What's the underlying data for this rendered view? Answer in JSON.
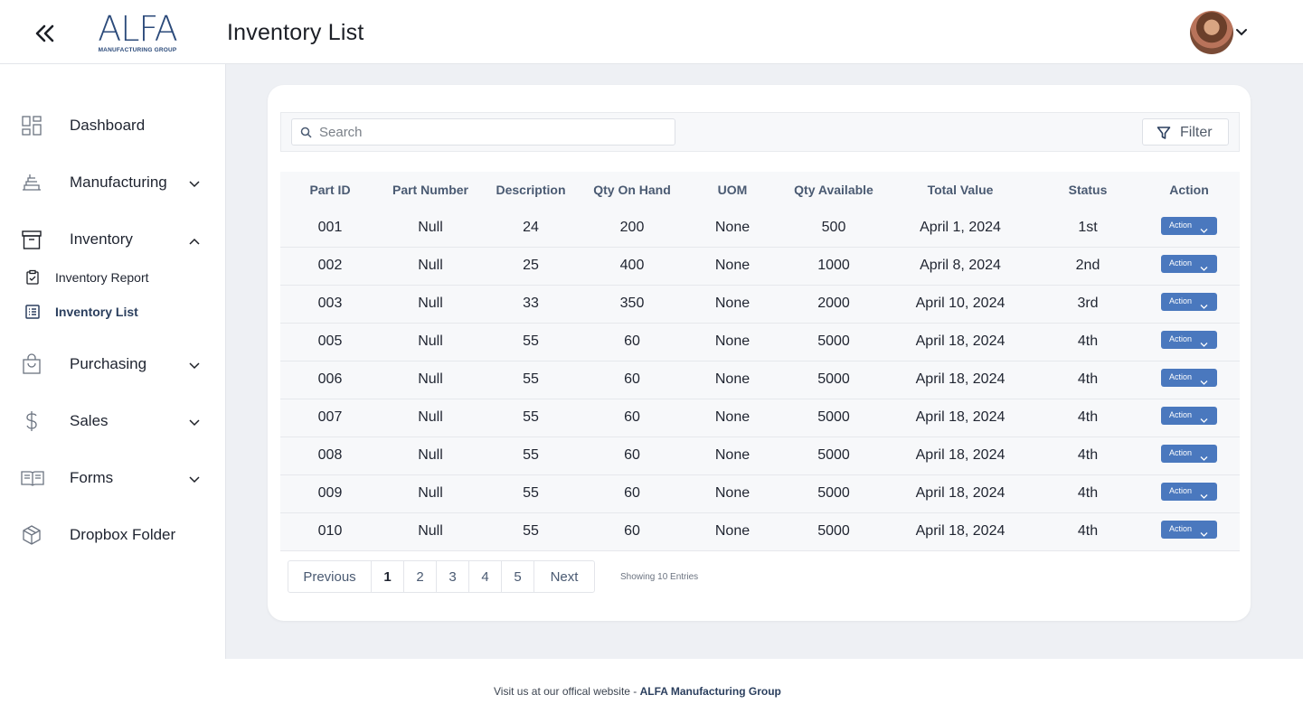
{
  "header": {
    "logo_text": "ALFA",
    "logo_subtitle": "MANUFACTURING GROUP",
    "page_title": "Inventory List"
  },
  "sidebar": {
    "items": [
      {
        "label": "Dashboard",
        "icon": "dashboard-grid-icon"
      },
      {
        "label": "Manufacturing",
        "icon": "manufacturing-icon",
        "expandable": true
      },
      {
        "label": "Inventory",
        "icon": "inventory-box-icon",
        "expanded": true
      },
      {
        "label": "Purchasing",
        "icon": "shopping-bag-icon",
        "expandable": true
      },
      {
        "label": "Sales",
        "icon": "dollar-icon",
        "expandable": true
      },
      {
        "label": "Forms",
        "icon": "book-icon",
        "expandable": true
      },
      {
        "label": "Dropbox Folder",
        "icon": "package-icon"
      }
    ],
    "inventory_sub": [
      {
        "label": "Inventory Report",
        "icon": "clipboard-icon"
      },
      {
        "label": "Inventory List",
        "icon": "list-icon",
        "active": true
      }
    ]
  },
  "toolbar": {
    "search_placeholder": "Search",
    "filter_label": "Filter"
  },
  "table": {
    "columns": [
      "Part ID",
      "Part Number",
      "Description",
      "Qty On Hand",
      "UOM",
      "Qty Available",
      "Total Value",
      "Status",
      "Action"
    ],
    "rows": [
      [
        "001",
        "Null",
        "24",
        "200",
        "None",
        "500",
        "April 1, 2024",
        "1st",
        "Action"
      ],
      [
        "002",
        "Null",
        "25",
        "400",
        "None",
        "1000",
        "April 8, 2024",
        "2nd",
        "Action"
      ],
      [
        "003",
        "Null",
        "33",
        "350",
        "None",
        "2000",
        "April 10, 2024",
        "3rd",
        "Action"
      ],
      [
        "005",
        "Null",
        "55",
        "60",
        "None",
        "5000",
        "April 18, 2024",
        "4th",
        "Action"
      ],
      [
        "006",
        "Null",
        "55",
        "60",
        "None",
        "5000",
        "April 18, 2024",
        "4th",
        "Action"
      ],
      [
        "007",
        "Null",
        "55",
        "60",
        "None",
        "5000",
        "April 18, 2024",
        "4th",
        "Action"
      ],
      [
        "008",
        "Null",
        "55",
        "60",
        "None",
        "5000",
        "April 18, 2024",
        "4th",
        "Action"
      ],
      [
        "009",
        "Null",
        "55",
        "60",
        "None",
        "5000",
        "April 18, 2024",
        "4th",
        "Action"
      ],
      [
        "010",
        "Null",
        "55",
        "60",
        "None",
        "5000",
        "April 18, 2024",
        "4th",
        "Action"
      ]
    ]
  },
  "pagination": {
    "previous": "Previous",
    "pages": [
      "1",
      "2",
      "3",
      "4",
      "5"
    ],
    "current": "1",
    "next": "Next",
    "showing": "Showing 10 Entries"
  },
  "footer": {
    "text": "Visit us at our offical website - ",
    "link": "ALFA Manufacturing Group"
  },
  "colors": {
    "accent": "#4a78be",
    "brand": "#2b4a7a",
    "background": "#eef0f4"
  }
}
